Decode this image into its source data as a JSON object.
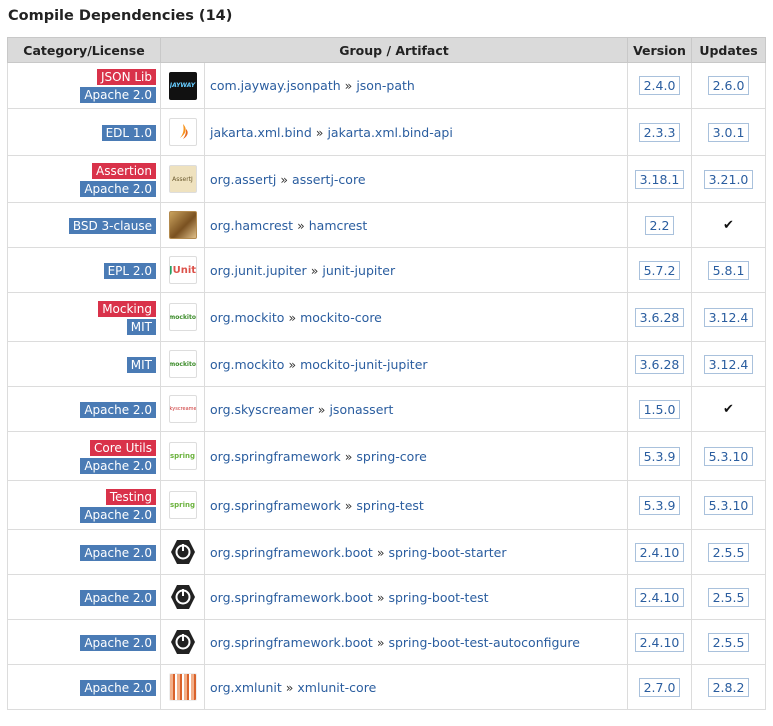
{
  "section_title": "Compile Dependencies (14)",
  "columns": [
    "Category/License",
    "Group / Artifact",
    "Version",
    "Updates"
  ],
  "rows": [
    {
      "categories": [
        "JSON Lib"
      ],
      "license": "Apache 2.0",
      "logo": "jayway-logo",
      "group": "com.jayway.jsonpath",
      "artifact": "json-path",
      "version": "2.4.0",
      "update": "2.6.0",
      "h": 46
    },
    {
      "categories": [],
      "license": "EDL 1.0",
      "logo": "jakarta-logo",
      "group": "jakarta.xml.bind",
      "artifact": "jakarta.xml.bind-api",
      "version": "2.3.3",
      "update": "3.0.1",
      "h": 47
    },
    {
      "categories": [
        "Assertion"
      ],
      "license": "Apache 2.0",
      "logo": "assertj-logo",
      "group": "org.assertj",
      "artifact": "assertj-core",
      "version": "3.18.1",
      "update": "3.21.0",
      "h": 47
    },
    {
      "categories": [],
      "license": "BSD 3-clause",
      "logo": "hamcrest-logo",
      "group": "org.hamcrest",
      "artifact": "hamcrest",
      "version": "2.2",
      "update": "✔",
      "h": 45
    },
    {
      "categories": [],
      "license": "EPL 2.0",
      "logo": "junit-logo",
      "group": "org.junit.jupiter",
      "artifact": "junit-jupiter",
      "version": "5.7.2",
      "update": "5.8.1",
      "h": 45
    },
    {
      "categories": [
        "Mocking"
      ],
      "license": "MIT",
      "logo": "mockito-logo",
      "group": "org.mockito",
      "artifact": "mockito-core",
      "version": "3.6.28",
      "update": "3.12.4",
      "h": 49
    },
    {
      "categories": [],
      "license": "MIT",
      "logo": "mockito-logo",
      "group": "org.mockito",
      "artifact": "mockito-junit-jupiter",
      "version": "3.6.28",
      "update": "3.12.4",
      "h": 45
    },
    {
      "categories": [],
      "license": "Apache 2.0",
      "logo": "skyscreamer-logo",
      "group": "org.skyscreamer",
      "artifact": "jsonassert",
      "version": "1.5.0",
      "update": "✔",
      "h": 45
    },
    {
      "categories": [
        "Core Utils"
      ],
      "license": "Apache 2.0",
      "logo": "spring-logo",
      "group": "org.springframework",
      "artifact": "spring-core",
      "version": "5.3.9",
      "update": "5.3.10",
      "h": 49
    },
    {
      "categories": [
        "Testing"
      ],
      "license": "Apache 2.0",
      "logo": "spring-logo",
      "group": "org.springframework",
      "artifact": "spring-test",
      "version": "5.3.9",
      "update": "5.3.10",
      "h": 49
    },
    {
      "categories": [],
      "license": "Apache 2.0",
      "logo": "spring-boot-logo",
      "group": "org.springframework.boot",
      "artifact": "spring-boot-starter",
      "version": "2.4.10",
      "update": "2.5.5",
      "h": 45
    },
    {
      "categories": [],
      "license": "Apache 2.0",
      "logo": "spring-boot-logo",
      "group": "org.springframework.boot",
      "artifact": "spring-boot-test",
      "version": "2.4.10",
      "update": "2.5.5",
      "h": 45
    },
    {
      "categories": [],
      "license": "Apache 2.0",
      "logo": "spring-boot-logo",
      "group": "org.springframework.boot",
      "artifact": "spring-boot-test-autoconfigure",
      "version": "2.4.10",
      "update": "2.5.5",
      "h": 45
    },
    {
      "categories": [],
      "license": "Apache 2.0",
      "logo": "xmlunit-logo",
      "group": "org.xmlunit",
      "artifact": "xmlunit-core",
      "version": "2.7.0",
      "update": "2.8.2",
      "h": 45
    }
  ],
  "logo_texts": {
    "jayway-logo": "JAYWAY",
    "jakarta-logo": "jakarta ee",
    "assertj-logo": "AssertJ",
    "junit-logo": "JUnit",
    "mockito-logo": "mockito",
    "skyscreamer-logo": "Skyscreamer",
    "spring-logo": "spring"
  }
}
